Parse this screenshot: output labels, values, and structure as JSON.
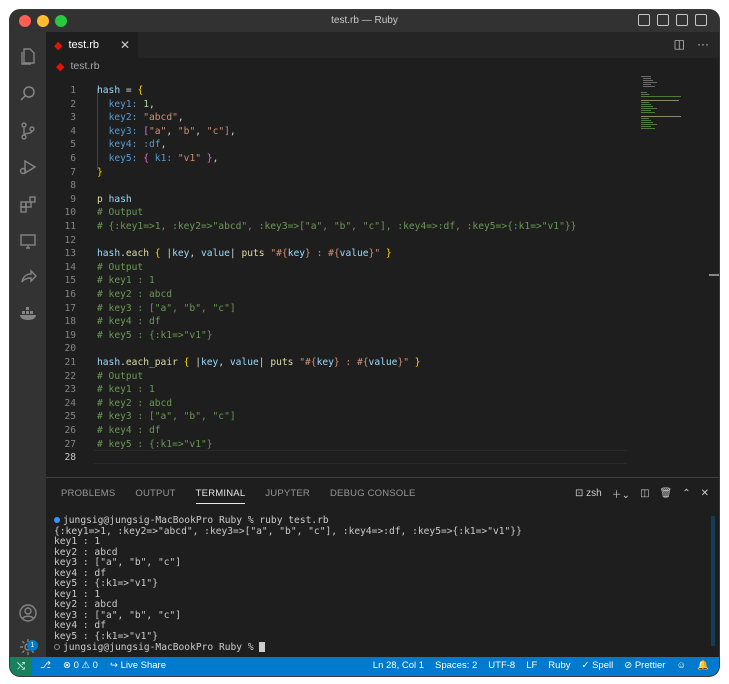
{
  "window": {
    "title": "test.rb — Ruby"
  },
  "traffic_colors": [
    "#ff5f57",
    "#febc2e",
    "#28c840"
  ],
  "activity": {
    "items": [
      "explorer-icon",
      "search-icon",
      "source-control-icon",
      "run-debug-icon",
      "extensions-icon",
      "remote-explorer-icon",
      "live-share-icon",
      "docker-icon"
    ],
    "bottom": [
      "account-icon",
      "settings-icon"
    ],
    "settings_badge": "1"
  },
  "tab": {
    "icon": "ruby-icon",
    "label": "test.rb"
  },
  "breadcrumb": {
    "file": "test.rb"
  },
  "editor": {
    "lines": [
      {
        "n": "1",
        "t": [
          [
            "k-var",
            "hash"
          ],
          [
            "k-plain",
            " = "
          ],
          [
            "k-brace",
            "{"
          ]
        ]
      },
      {
        "n": "2",
        "t": [
          [
            "k-plain",
            "  "
          ],
          [
            "k-sym",
            "key1:"
          ],
          [
            "k-plain",
            " "
          ],
          [
            "k-num",
            "1"
          ],
          [
            "k-plain",
            ","
          ]
        ]
      },
      {
        "n": "3",
        "t": [
          [
            "k-plain",
            "  "
          ],
          [
            "k-sym",
            "key2:"
          ],
          [
            "k-plain",
            " "
          ],
          [
            "k-str",
            "\"abcd\""
          ],
          [
            "k-plain",
            ","
          ]
        ]
      },
      {
        "n": "4",
        "t": [
          [
            "k-plain",
            "  "
          ],
          [
            "k-sym",
            "key3:"
          ],
          [
            "k-plain",
            " "
          ],
          [
            "k-brace2",
            "["
          ],
          [
            "k-str",
            "\"a\""
          ],
          [
            "k-plain",
            ", "
          ],
          [
            "k-str",
            "\"b\""
          ],
          [
            "k-plain",
            ", "
          ],
          [
            "k-str",
            "\"c\""
          ],
          [
            "k-brace2",
            "]"
          ],
          [
            "k-plain",
            ","
          ]
        ]
      },
      {
        "n": "5",
        "t": [
          [
            "k-plain",
            "  "
          ],
          [
            "k-sym",
            "key4:"
          ],
          [
            "k-plain",
            " "
          ],
          [
            "k-sym",
            ":df"
          ],
          [
            "k-plain",
            ","
          ]
        ]
      },
      {
        "n": "6",
        "t": [
          [
            "k-plain",
            "  "
          ],
          [
            "k-sym",
            "key5:"
          ],
          [
            "k-plain",
            " "
          ],
          [
            "k-brace2",
            "{"
          ],
          [
            "k-plain",
            " "
          ],
          [
            "k-sym",
            "k1:"
          ],
          [
            "k-plain",
            " "
          ],
          [
            "k-str",
            "\"v1\""
          ],
          [
            "k-plain",
            " "
          ],
          [
            "k-brace2",
            "}"
          ],
          [
            "k-plain",
            ","
          ]
        ]
      },
      {
        "n": "7",
        "t": [
          [
            "k-brace",
            "}"
          ]
        ]
      },
      {
        "n": "8",
        "t": []
      },
      {
        "n": "9",
        "t": [
          [
            "k-def",
            "p"
          ],
          [
            "k-plain",
            " "
          ],
          [
            "k-var",
            "hash"
          ]
        ]
      },
      {
        "n": "10",
        "t": [
          [
            "k-cmt",
            "# Output"
          ]
        ]
      },
      {
        "n": "11",
        "t": [
          [
            "k-cmt",
            "# {:key1=>1, :key2=>\"abcd\", :key3=>[\"a\", \"b\", \"c\"], :key4=>:df, :key5=>{:k1=>\"v1\"}}"
          ]
        ]
      },
      {
        "n": "12",
        "t": []
      },
      {
        "n": "13",
        "t": [
          [
            "k-var",
            "hash"
          ],
          [
            "k-plain",
            "."
          ],
          [
            "k-def",
            "each"
          ],
          [
            "k-plain",
            " "
          ],
          [
            "k-brace",
            "{"
          ],
          [
            "k-plain",
            " |"
          ],
          [
            "k-var",
            "key"
          ],
          [
            "k-plain",
            ", "
          ],
          [
            "k-var",
            "value"
          ],
          [
            "k-plain",
            "| "
          ],
          [
            "k-def",
            "puts"
          ],
          [
            "k-plain",
            " "
          ],
          [
            "k-str",
            "\"#{"
          ],
          [
            "k-var",
            "key"
          ],
          [
            "k-str",
            "} : #{"
          ],
          [
            "k-var",
            "value"
          ],
          [
            "k-str",
            "}\""
          ],
          [
            "k-plain",
            " "
          ],
          [
            "k-brace",
            "}"
          ]
        ]
      },
      {
        "n": "14",
        "t": [
          [
            "k-cmt",
            "# Output"
          ]
        ]
      },
      {
        "n": "15",
        "t": [
          [
            "k-cmt",
            "# key1 : 1"
          ]
        ]
      },
      {
        "n": "16",
        "t": [
          [
            "k-cmt",
            "# key2 : abcd"
          ]
        ]
      },
      {
        "n": "17",
        "t": [
          [
            "k-cmt",
            "# key3 : [\"a\", \"b\", \"c\"]"
          ]
        ]
      },
      {
        "n": "18",
        "t": [
          [
            "k-cmt",
            "# key4 : df"
          ]
        ]
      },
      {
        "n": "19",
        "t": [
          [
            "k-cmt",
            "# key5 : {:k1=>\"v1\"}"
          ]
        ]
      },
      {
        "n": "20",
        "t": []
      },
      {
        "n": "21",
        "t": [
          [
            "k-var",
            "hash"
          ],
          [
            "k-plain",
            "."
          ],
          [
            "k-def",
            "each_pair"
          ],
          [
            "k-plain",
            " "
          ],
          [
            "k-brace",
            "{"
          ],
          [
            "k-plain",
            " |"
          ],
          [
            "k-var",
            "key"
          ],
          [
            "k-plain",
            ", "
          ],
          [
            "k-var",
            "value"
          ],
          [
            "k-plain",
            "| "
          ],
          [
            "k-def",
            "puts"
          ],
          [
            "k-plain",
            " "
          ],
          [
            "k-str",
            "\"#{"
          ],
          [
            "k-var",
            "key"
          ],
          [
            "k-str",
            "} : #{"
          ],
          [
            "k-var",
            "value"
          ],
          [
            "k-str",
            "}\""
          ],
          [
            "k-plain",
            " "
          ],
          [
            "k-brace",
            "}"
          ]
        ]
      },
      {
        "n": "22",
        "t": [
          [
            "k-cmt",
            "# Output"
          ]
        ]
      },
      {
        "n": "23",
        "t": [
          [
            "k-cmt",
            "# key1 : 1"
          ]
        ]
      },
      {
        "n": "24",
        "t": [
          [
            "k-cmt",
            "# key2 : abcd"
          ]
        ]
      },
      {
        "n": "25",
        "t": [
          [
            "k-cmt",
            "# key3 : [\"a\", \"b\", \"c\"]"
          ]
        ]
      },
      {
        "n": "26",
        "t": [
          [
            "k-cmt",
            "# key4 : df"
          ]
        ]
      },
      {
        "n": "27",
        "t": [
          [
            "k-cmt",
            "# key5 : {:k1=>\"v1\"}"
          ]
        ]
      },
      {
        "n": "28",
        "t": []
      }
    ],
    "active_line": "28"
  },
  "panel": {
    "tabs": [
      "PROBLEMS",
      "OUTPUT",
      "TERMINAL",
      "JUPYTER",
      "DEBUG CONSOLE"
    ],
    "active_tab": "TERMINAL",
    "shell": "zsh",
    "terminal": [
      {
        "mark": "blue",
        "text": "jungsig@jungsig-MacBookPro Ruby % ruby test.rb"
      },
      {
        "mark": "",
        "text": "{:key1=>1, :key2=>\"abcd\", :key3=>[\"a\", \"b\", \"c\"], :key4=>:df, :key5=>{:k1=>\"v1\"}}"
      },
      {
        "mark": "",
        "text": "key1 : 1"
      },
      {
        "mark": "",
        "text": "key2 : abcd"
      },
      {
        "mark": "",
        "text": "key3 : [\"a\", \"b\", \"c\"]"
      },
      {
        "mark": "",
        "text": "key4 : df"
      },
      {
        "mark": "",
        "text": "key5 : {:k1=>\"v1\"}"
      },
      {
        "mark": "",
        "text": "key1 : 1"
      },
      {
        "mark": "",
        "text": "key2 : abcd"
      },
      {
        "mark": "",
        "text": "key3 : [\"a\", \"b\", \"c\"]"
      },
      {
        "mark": "",
        "text": "key4 : df"
      },
      {
        "mark": "",
        "text": "key5 : {:k1=>\"v1\"}"
      },
      {
        "mark": "empty",
        "text": "jungsig@jungsig-MacBookPro Ruby % "
      }
    ]
  },
  "status": {
    "errors": "0",
    "warnings": "0",
    "live_share": "Live Share",
    "position": "Ln 28, Col 1",
    "spaces": "Spaces: 2",
    "encoding": "UTF-8",
    "eol": "LF",
    "language": "Ruby",
    "spell": "Spell",
    "prettier": "Prettier"
  }
}
